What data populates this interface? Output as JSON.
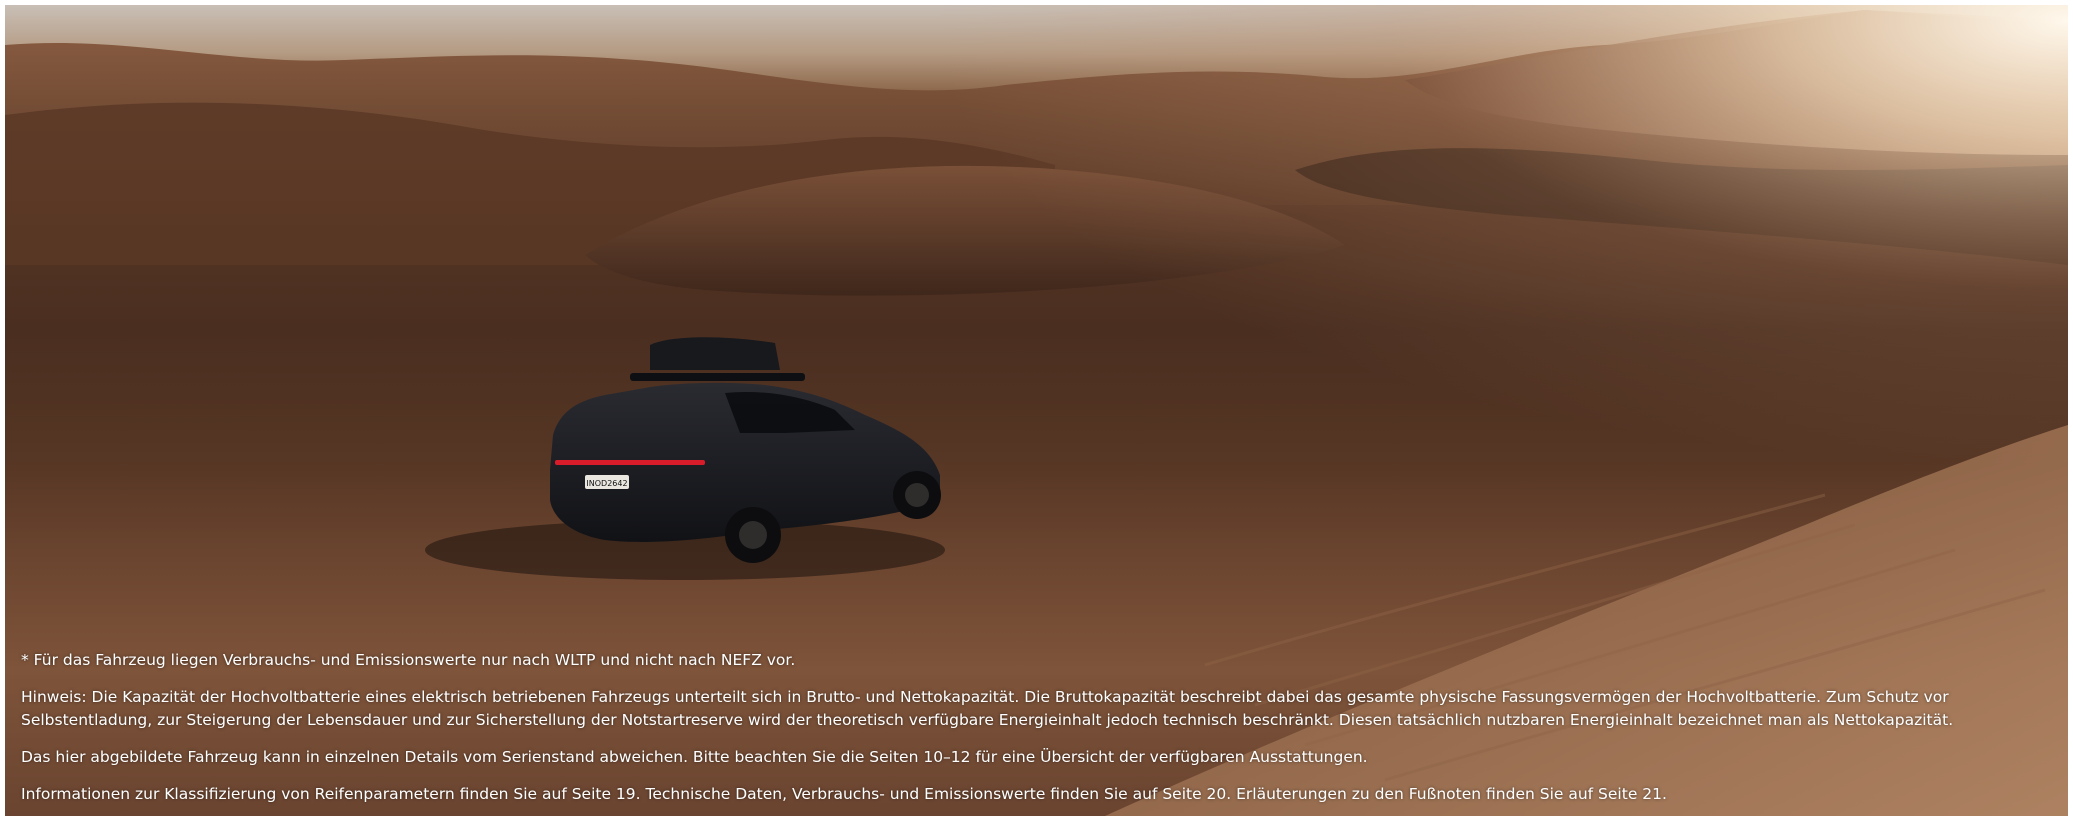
{
  "hero": {
    "image": "desert-suv-photo",
    "license_plate": "INOD2642"
  },
  "footnotes": {
    "wltp_note": "* Für das Fahrzeug liegen Verbrauchs- und Emissionswerte nur nach WLTP und nicht nach NEFZ vor.",
    "battery_note": "Hinweis: Die Kapazität der Hochvoltbatterie eines elektrisch betriebenen Fahrzeugs unterteilt sich in Brutto- und Nettokapazität. Die Bruttokapazität beschreibt dabei das gesamte physische Fassungsvermögen der Hochvoltbatterie. Zum Schutz vor Selbstentladung, zur Steigerung der Lebensdauer und zur Sicherstellung der Notstartreserve wird der theoretisch verfügbare Energieinhalt jedoch technisch beschränkt. Diesen tatsächlich nutzbaren Energieinhalt bezeichnet man als Nettokapazität.",
    "vehicle_note": "Das hier abgebildete Fahrzeug kann in einzelnen Details vom Serienstand abweichen. Bitte beachten Sie die Seiten 10–12 für eine Übersicht der verfügbaren Ausstattungen.",
    "info_note": "Informationen zur Klassifizierung von Reifenparametern finden Sie auf Seite 19. Technische Daten, Verbrauchs- und Emissionswerte finden Sie auf Seite 20. Erläuterungen zu den Fußnoten finden Sie auf Seite 21."
  }
}
